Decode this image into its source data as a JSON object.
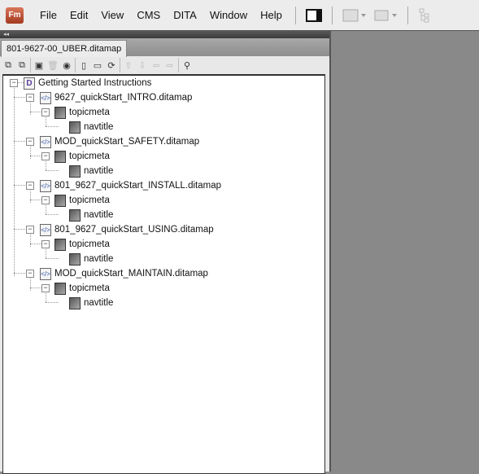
{
  "menubar": {
    "logo": "Fm",
    "items": [
      "File",
      "Edit",
      "View",
      "CMS",
      "DITA",
      "Window",
      "Help"
    ]
  },
  "panel": {
    "collapse": "◂◂",
    "tab": "801-9627-00_UBER.ditamap"
  },
  "tree": {
    "root": "Getting Started Instructions",
    "maps": [
      {
        "name": "9627_quickStart_INTRO.ditamap",
        "meta": "topicmeta",
        "nav": "navtitle"
      },
      {
        "name": "MOD_quickStart_SAFETY.ditamap",
        "meta": "topicmeta",
        "nav": "navtitle"
      },
      {
        "name": "801_9627_quickStart_INSTALL.ditamap",
        "meta": "topicmeta",
        "nav": "navtitle"
      },
      {
        "name": "801_9627_quickStart_USING.ditamap",
        "meta": "topicmeta",
        "nav": "navtitle"
      },
      {
        "name": "MOD_quickStart_MAINTAIN.ditamap",
        "meta": "topicmeta",
        "nav": "navtitle"
      }
    ]
  }
}
